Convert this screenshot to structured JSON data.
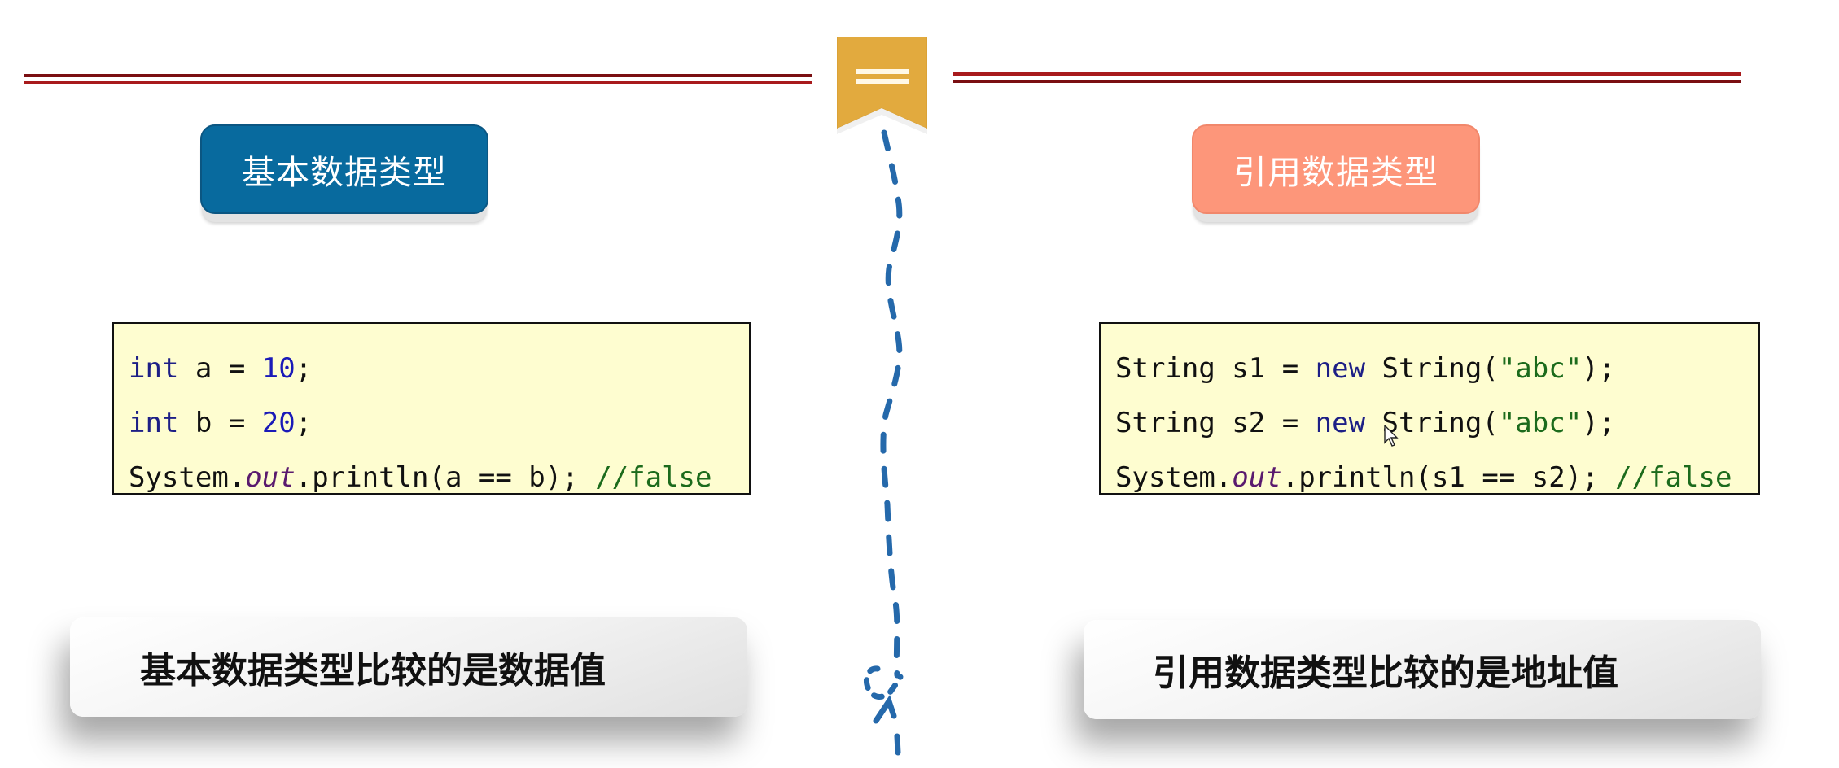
{
  "colors": {
    "rule_dark": "#7a0f12",
    "rule_red": "#a81a1c",
    "ribbon": "#e2aa3e",
    "basic_button": "#086a9e",
    "reference_button": "#fd967a",
    "code_background": "#fefdd0",
    "dashed_path": "#2569ab"
  },
  "ribbon_icon": "equals-icon",
  "left": {
    "heading": "基本数据类型",
    "code": {
      "line1": {
        "type": "int",
        "rest": " a = ",
        "num": "10",
        "end": ";"
      },
      "line2": {
        "type": "int",
        "rest": " b = ",
        "num": "20",
        "end": ";"
      },
      "line3": {
        "prefix": "System.",
        "field": "out",
        "call": ".println(a == b); ",
        "comment": "//false"
      }
    },
    "conclusion": "基本数据类型比较的是数据值"
  },
  "right": {
    "heading": "引用数据类型",
    "code": {
      "line1": {
        "type": "String s1 = ",
        "kw": "new",
        "ctor": " String(",
        "str": "\"abc\"",
        "end": ");"
      },
      "line2": {
        "type": "String s2 = ",
        "kw": "new",
        "ctor": " String(",
        "str": "\"abc\"",
        "end": ");"
      },
      "line3": {
        "prefix": "System.",
        "field": "out",
        "call": ".println(s1 == s2); ",
        "comment": "//false"
      }
    },
    "conclusion": "引用数据类型比较的是地址值"
  }
}
